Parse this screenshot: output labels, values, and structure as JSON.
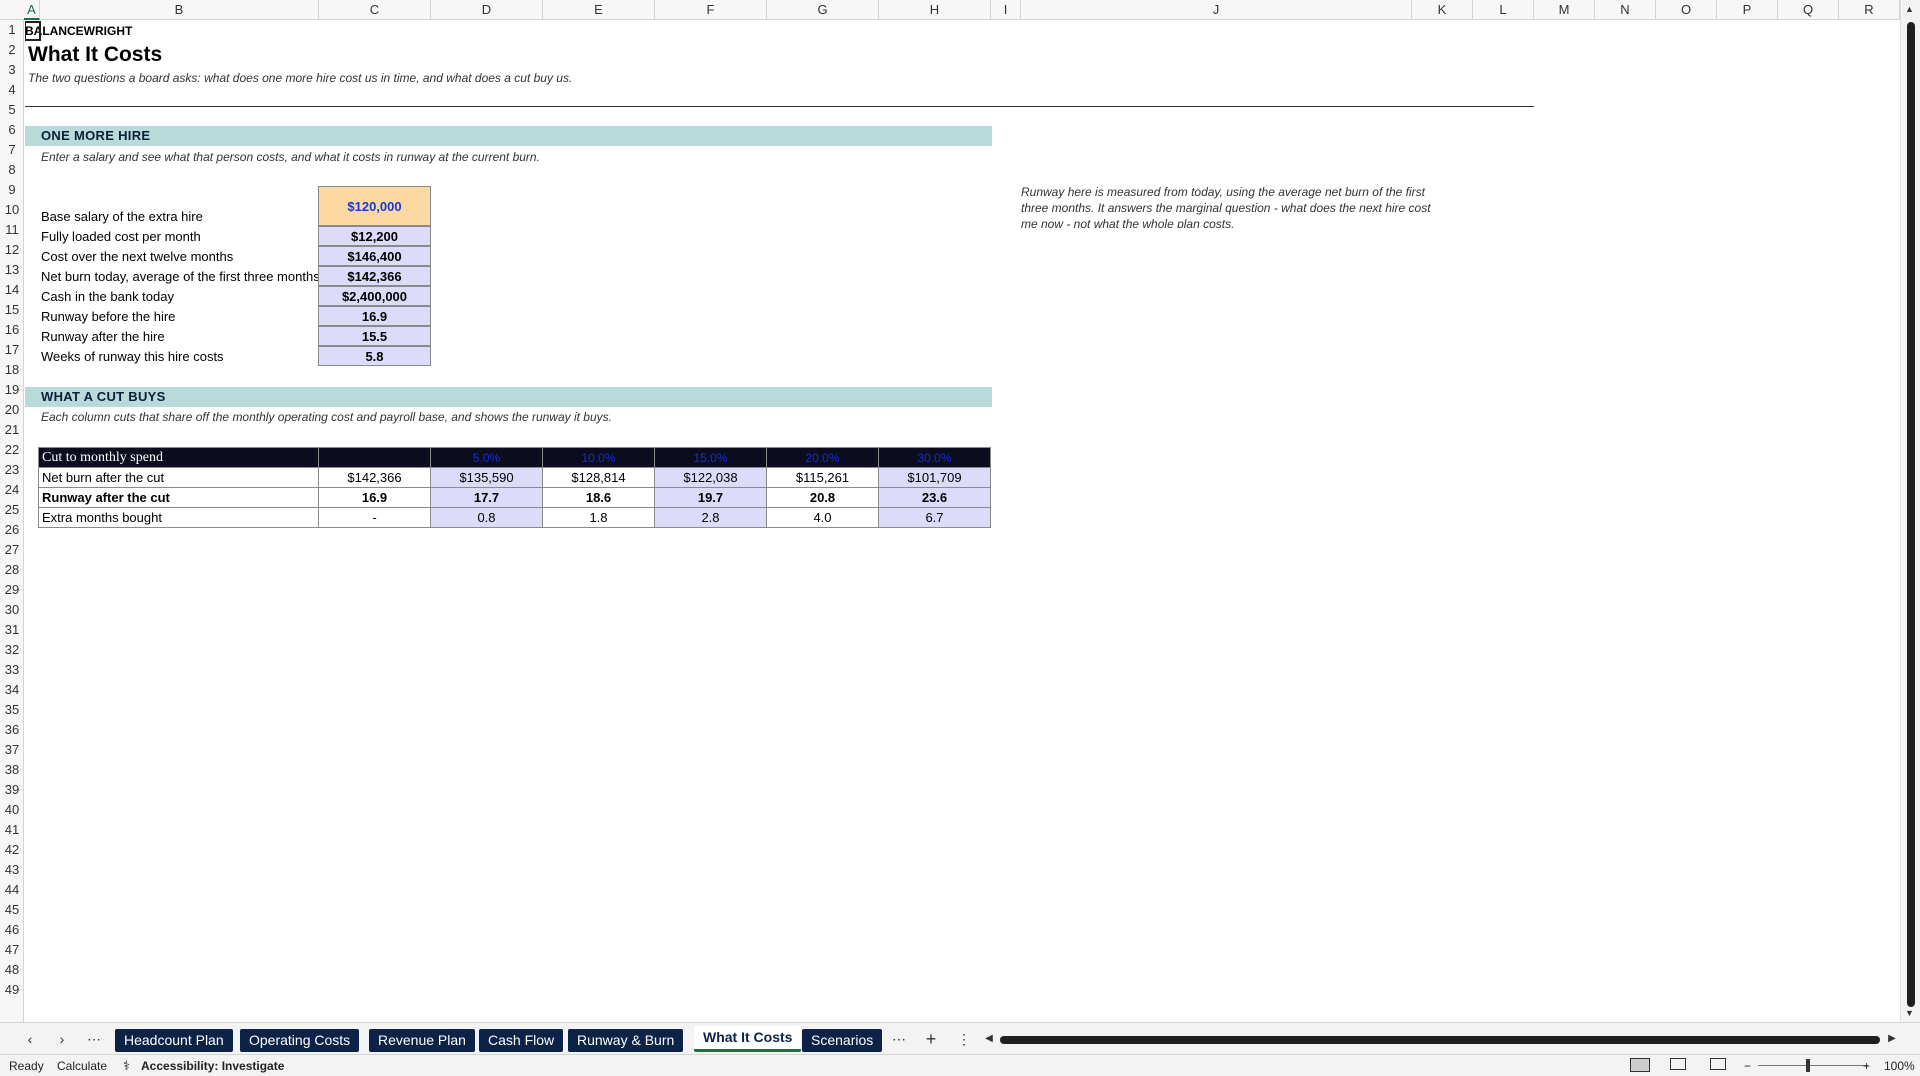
{
  "columns": [
    "A",
    "B",
    "C",
    "D",
    "E",
    "F",
    "G",
    "H",
    "I",
    "J",
    "K",
    "L",
    "M",
    "N",
    "O",
    "P",
    "Q",
    "R"
  ],
  "rows": [
    "1",
    "2",
    "3",
    "4",
    "5",
    "6",
    "7",
    "8",
    "9",
    "10",
    "11",
    "12",
    "13",
    "14",
    "15",
    "16",
    "17",
    "18",
    "19",
    "20",
    "21",
    "22",
    "23",
    "24",
    "25",
    "26",
    "27",
    "28",
    "29",
    "30",
    "31",
    "32",
    "33",
    "34",
    "35",
    "36",
    "37",
    "38",
    "39",
    "40",
    "41",
    "42",
    "43",
    "44",
    "45",
    "46",
    "47",
    "48",
    "49"
  ],
  "sheet": {
    "brand": "BALANCEWRIGHT",
    "title": "What It Costs",
    "subtitle": "The two questions a board asks: what does one more hire cost us in time, and what does a cut buy us.",
    "hire": {
      "heading": "ONE MORE HIRE",
      "note": "Enter a salary and see what that person costs, and what it costs in runway at the current burn.",
      "rows": [
        {
          "label": "Base salary of the extra hire",
          "value": "$120,000"
        },
        {
          "label": "Fully loaded cost per month",
          "value": "$12,200"
        },
        {
          "label": "Cost over the next twelve months",
          "value": "$146,400"
        },
        {
          "label": "Net burn today, average of the first three months",
          "value": "$142,366"
        },
        {
          "label": "Cash in the bank today",
          "value": "$2,400,000"
        },
        {
          "label": "Runway before the hire",
          "value": "16.9"
        },
        {
          "label": "Runway after the hire",
          "value": "15.5"
        },
        {
          "label": "Weeks of runway this hire costs",
          "value": "5.8"
        }
      ],
      "side_note": "Runway here is measured from today, using the average net burn of the first three months. It answers the marginal question - what does the next hire cost me now - not what the whole plan costs."
    },
    "cut": {
      "heading": "WHAT A CUT BUYS",
      "note": "Each column cuts that share off the monthly operating cost and payroll base, and shows the runway it buys.",
      "header": {
        "label": "Cut to monthly spend",
        "base": "",
        "pcts": [
          "5.0%",
          "10.0%",
          "15.0%",
          "20.0%",
          "30.0%"
        ]
      },
      "rows": [
        {
          "label": "Net burn after the cut",
          "base": "$142,366",
          "vals": [
            "$135,590",
            "$128,814",
            "$122,038",
            "$115,261",
            "$101,709"
          ]
        },
        {
          "label": "Runway after the cut",
          "base": "16.9",
          "vals": [
            "17.7",
            "18.6",
            "19.7",
            "20.8",
            "23.6"
          ]
        },
        {
          "label": "Extra months bought",
          "base": "-",
          "vals": [
            "0.8",
            "1.8",
            "2.8",
            "4.0",
            "6.7"
          ]
        }
      ]
    }
  },
  "tabs": [
    "Headcount Plan",
    "Operating Costs",
    "Revenue Plan",
    "Cash Flow",
    "Runway & Burn",
    "What It Costs",
    "Scenarios"
  ],
  "active_tab": "What It Costs",
  "status": {
    "ready": "Ready",
    "calculate": "Calculate",
    "accessibility": "Accessibility: Investigate",
    "zoom": "100%"
  },
  "colors": {
    "band": "#b8dad8",
    "input": "#fcd9a2",
    "calc": "#dcdcfa",
    "header_dark": "#0c0c1f",
    "tab": "#0c2247"
  }
}
